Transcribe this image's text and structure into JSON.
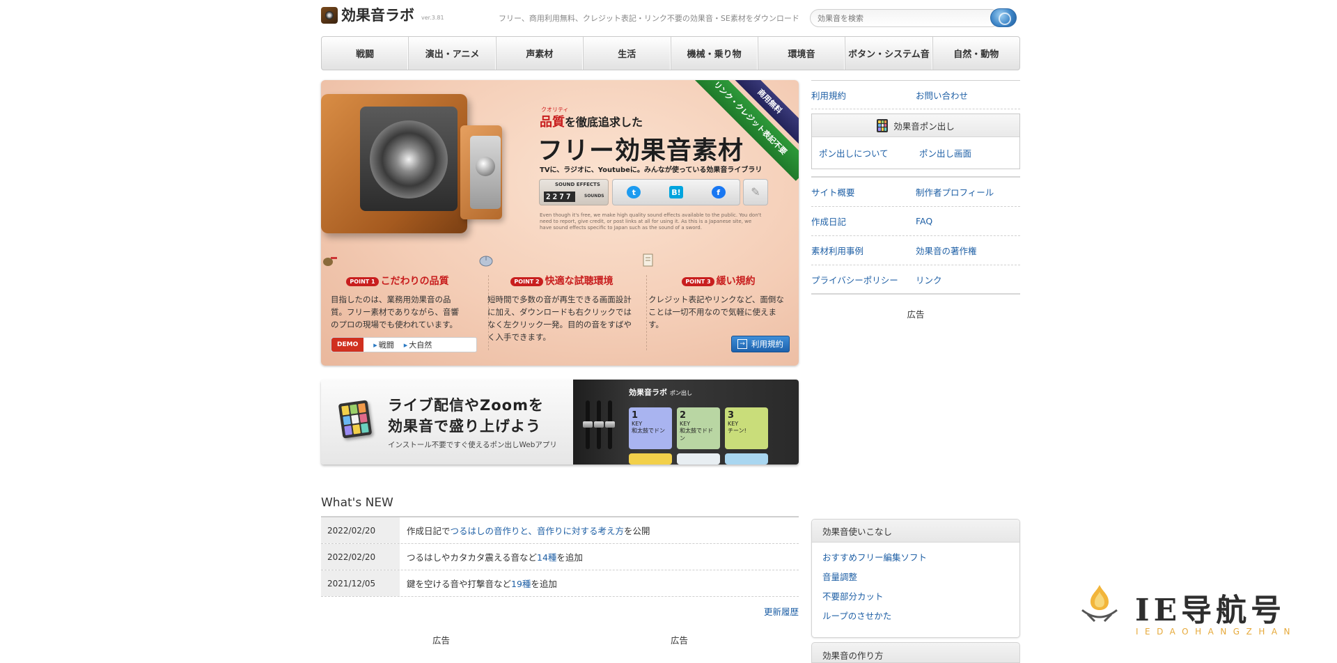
{
  "header": {
    "logo_text": "効果音ラボ",
    "version": "ver.3.81",
    "tagline": "フリー、商用利用無料、クレジット表記・リンク不要の効果音・SE素材をダウンロード",
    "search_placeholder": "効果音を検索"
  },
  "nav": {
    "items": [
      "戦闘",
      "演出・アニメ",
      "声素材",
      "生活",
      "機械・乗り物",
      "環境音",
      "ボタン・システム音",
      "自然・動物"
    ]
  },
  "hero": {
    "ribbon_top": "商用無料",
    "ribbon_bottom": "リンク・クレジット表記不要",
    "ruby": "クオリティ",
    "sub1_red": "品質",
    "sub1_rest": "を徹底追求した",
    "title": "フリー効果音素材",
    "sub2": "TVに、ラジオに、Youtubeに。みんなが使っている効果音ライブラリ",
    "counter_label": "SOUND EFFECTS",
    "counter_value": "2277",
    "counter_unit": "SOUNDS",
    "english_note": "Even though it's free, we make high quality sound effects available to the public. You don't need to report, give credit, or post links at all for using it. As this is a Japanese site, we have sound effects specific to Japan such as the sound of a sword.",
    "points": [
      {
        "tag": "POINT 1",
        "title": "こだわりの品質",
        "desc": "目指したのは、業務用効果音の品質。フリー素材でありながら、音響のプロの現場でも使われています。"
      },
      {
        "tag": "POINT 2",
        "title": "快適な試聴環境",
        "desc": "短時間で多数の音が再生できる画面設計に加え、ダウンロードも右クリックではなく左クリック一発。目的の音をすばやく入手できます。"
      },
      {
        "tag": "POINT 3",
        "title": "緩い規約",
        "desc": "クレジット表記やリンクなど、面倒なことは一切不用なので気軽に使えます。"
      }
    ],
    "demo_label": "DEMO",
    "demo_links": [
      "戦闘",
      "大自然"
    ],
    "terms_button": "利用規約"
  },
  "live_banner": {
    "title_line1": "ライブ配信やZoomを",
    "title_line2": "効果音で盛り上げよう",
    "subtitle": "インストール不要ですぐ使えるポン出しWebアプリ",
    "panel_title": "効果音ラボ",
    "panel_small": "ポン出し",
    "pads": [
      {
        "key": "1",
        "label": "和太鼓でドン",
        "color": "#a9b4f0"
      },
      {
        "key": "2",
        "label": "和太鼓でドドン",
        "color": "#b9d6a3"
      },
      {
        "key": "3",
        "label": "チーン!",
        "color": "#c9dd7a"
      }
    ],
    "pad_key_label": "KEY"
  },
  "whats_new": {
    "title": "What's NEW",
    "rows": [
      {
        "date": "2022/02/20",
        "pre": "作成日記で",
        "hl": "つるはしの音作りと、音作りに対する考え方",
        "post": "を公開"
      },
      {
        "date": "2022/02/20",
        "pre": "つるはしやカタカタ震える音など",
        "hl": "14種",
        "post": "を追加"
      },
      {
        "date": "2021/12/05",
        "pre": "鍵を空ける音や打撃音など",
        "hl": "19種",
        "post": "を追加"
      }
    ],
    "more_link": "更新履歴",
    "ad_left": "広告",
    "ad_right": "広告"
  },
  "side": {
    "top_links": [
      "利用規約",
      "お問い合わせ"
    ],
    "pon_title": "効果音ポン出し",
    "pon_links": [
      "ポン出しについて",
      "ポン出し画面"
    ],
    "rows": [
      [
        "サイト概要",
        "制作者プロフィール"
      ],
      [
        "作成日記",
        "FAQ"
      ],
      [
        "素材利用事例",
        "効果音の著作権"
      ],
      [
        "プライバシーポリシー",
        "リンク"
      ]
    ],
    "ad": "広告",
    "tips_title": "効果音使いこなし",
    "tips": [
      "おすすめフリー編集ソフト",
      "音量調整",
      "不要部分カット",
      "ループのさせかた"
    ],
    "tips2_title": "効果音の作り方"
  },
  "watermark": {
    "text": "IE导航号",
    "sub": "IEDAOHANGZHAN"
  },
  "colors": {
    "link": "#1e5fa5",
    "accent_red": "#c81e1e",
    "ribbon_green": "#2e9a3a"
  }
}
